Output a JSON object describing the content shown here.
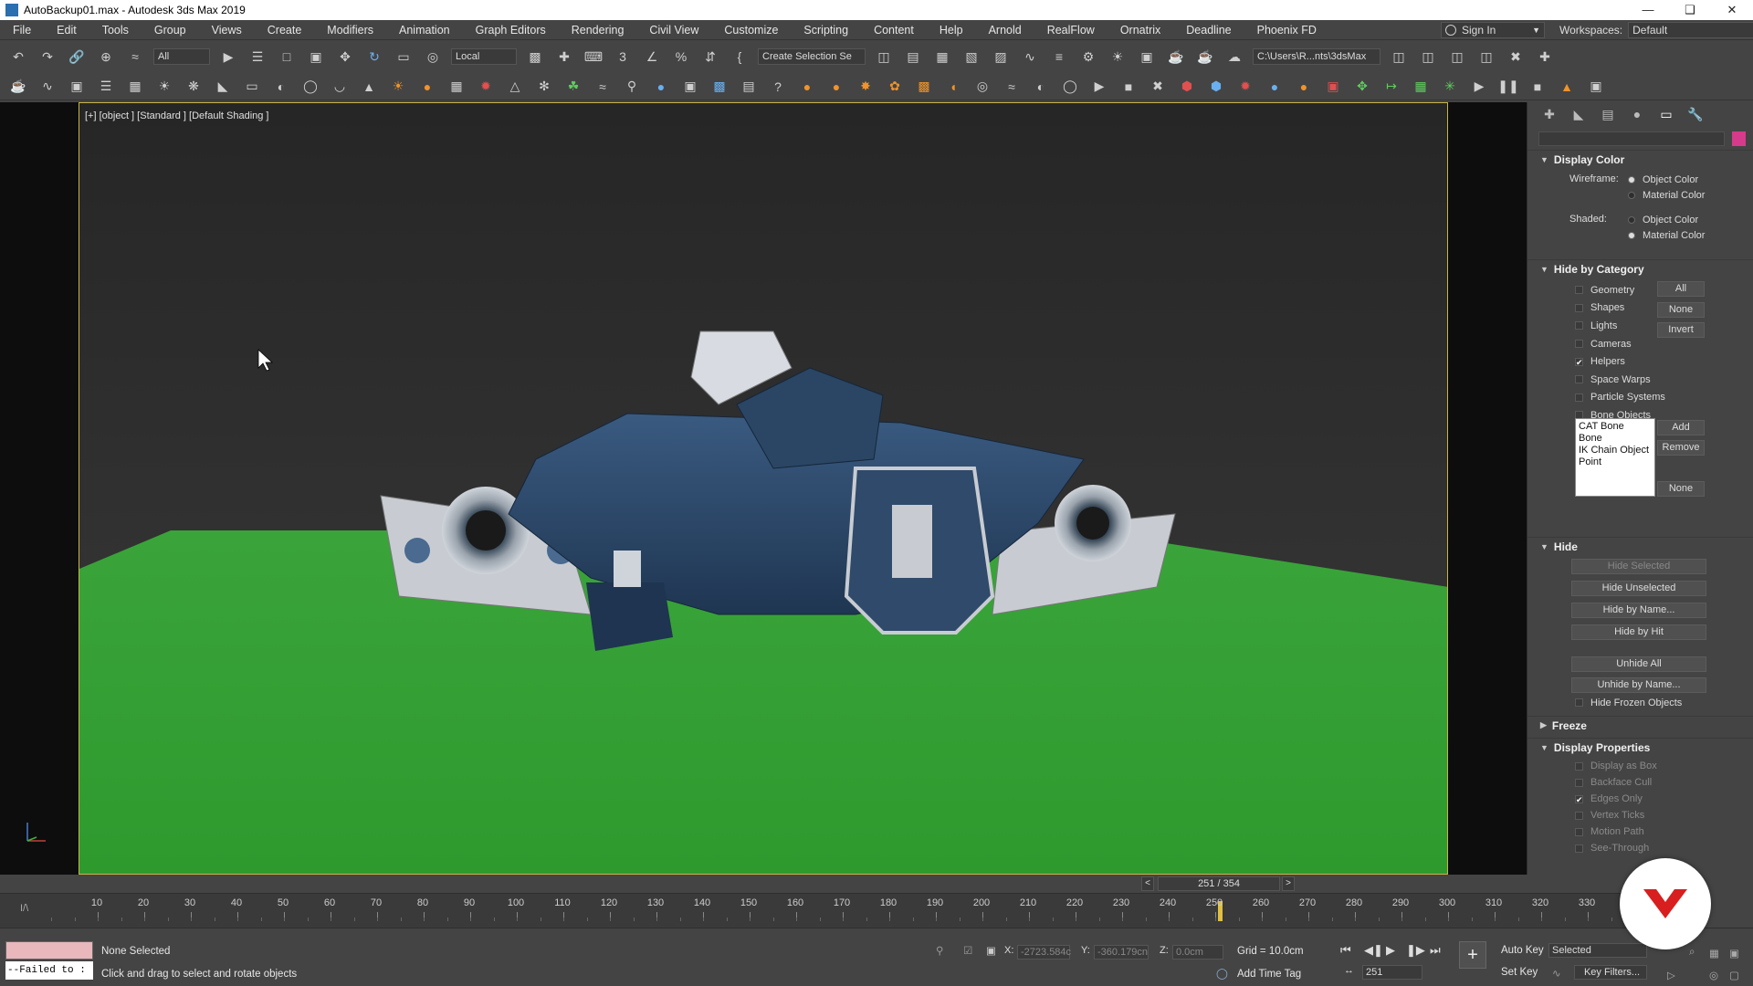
{
  "window": {
    "title": "AutoBackup01.max - Autodesk 3ds Max 2019"
  },
  "menu": [
    "File",
    "Edit",
    "Tools",
    "Group",
    "Views",
    "Create",
    "Modifiers",
    "Animation",
    "Graph Editors",
    "Rendering",
    "Civil View",
    "Customize",
    "Scripting",
    "Content",
    "Help",
    "Arnold",
    "RealFlow",
    "Ornatrix",
    "Deadline",
    "Phoenix FD"
  ],
  "account": {
    "sign_in": "Sign In",
    "workspaces_label": "Workspaces:",
    "workspace_value": "Default"
  },
  "toolbar": {
    "selection_filter": "All",
    "ref_coord": "Local",
    "named_selection": "Create Selection Se",
    "project_path": "C:\\Users\\R...nts\\3dsMax"
  },
  "viewport": {
    "label": "[+] [object ] [Standard ] [Default Shading ]"
  },
  "panel": {
    "display_color": {
      "title": "Display Color",
      "wireframe_label": "Wireframe:",
      "shaded_label": "Shaded:",
      "opt_object": "Object Color",
      "opt_material": "Material Color",
      "wireframe_selected": "Object Color",
      "shaded_selected": "Material Color"
    },
    "hide_by_category": {
      "title": "Hide by Category",
      "items": [
        {
          "label": "Geometry",
          "checked": false
        },
        {
          "label": "Shapes",
          "checked": false
        },
        {
          "label": "Lights",
          "checked": false
        },
        {
          "label": "Cameras",
          "checked": false
        },
        {
          "label": "Helpers",
          "checked": true
        },
        {
          "label": "Space Warps",
          "checked": false
        },
        {
          "label": "Particle Systems",
          "checked": false
        },
        {
          "label": "Bone Objects",
          "checked": false
        }
      ],
      "btn_all": "All",
      "btn_none": "None",
      "btn_invert": "Invert",
      "list": [
        "CAT Bone",
        "Bone",
        "IK Chain Object",
        "Point"
      ],
      "btn_add": "Add",
      "btn_remove": "Remove",
      "btn_none2": "None"
    },
    "hide": {
      "title": "Hide",
      "hide_selected": "Hide Selected",
      "hide_unselected": "Hide Unselected",
      "hide_by_name": "Hide by Name...",
      "hide_by_hit": "Hide by Hit",
      "unhide_all": "Unhide All",
      "unhide_by_name": "Unhide by Name...",
      "hide_frozen": "Hide Frozen Objects"
    },
    "freeze": {
      "title": "Freeze"
    },
    "display_properties": {
      "title": "Display Properties",
      "items": [
        {
          "label": "Display as Box",
          "checked": false
        },
        {
          "label": "Backface Cull",
          "checked": false
        },
        {
          "label": "Edges Only",
          "checked": true
        },
        {
          "label": "Vertex Ticks",
          "checked": false
        },
        {
          "label": "Motion Path",
          "checked": false
        },
        {
          "label": "See-Through",
          "checked": false
        }
      ]
    }
  },
  "timeline": {
    "frame_counter": "251 / 354",
    "current_frame": 251,
    "ticks": [
      10,
      20,
      30,
      40,
      50,
      60,
      70,
      80,
      90,
      100,
      110,
      120,
      130,
      140,
      150,
      160,
      170,
      180,
      190,
      200,
      210,
      220,
      230,
      240,
      250,
      260,
      270,
      280,
      290,
      300,
      310,
      320,
      330
    ]
  },
  "status": {
    "selection": "None Selected",
    "prompt": "Click and drag to select and rotate objects",
    "script_text": "--Failed to :",
    "x_label": "X:",
    "x_value": "-2723.584c",
    "y_label": "Y:",
    "y_value": "-360.179cn",
    "z_label": "Z:",
    "z_value": "0.0cm",
    "grid": "Grid = 10.0cm",
    "add_time_tag": "Add Time Tag",
    "auto_key": "Auto Key",
    "set_key": "Set Key",
    "key_mode": "Selected",
    "key_filters": "Key Filters...",
    "frame_field": "251"
  }
}
